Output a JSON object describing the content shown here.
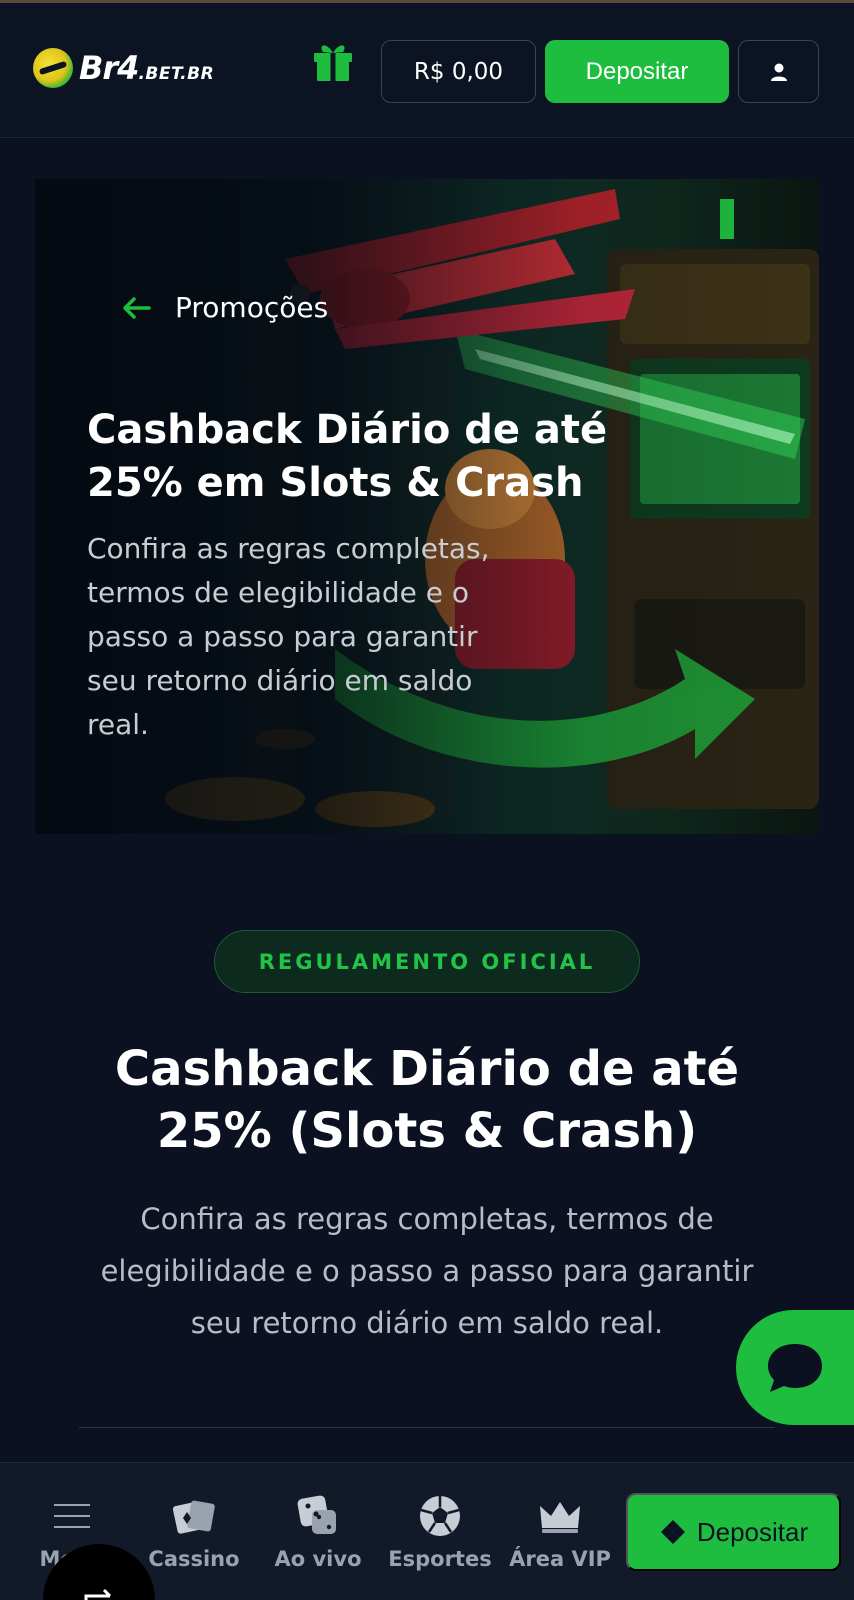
{
  "header": {
    "logo": {
      "brand": "Br4",
      "suffix": ".BET.BR"
    },
    "balance": "R$ 0,00",
    "deposit_label": "Depositar"
  },
  "banner": {
    "back_label": "Promoções",
    "title": "Cashback Diário de até 25% em Slots & Crash",
    "subtitle": "Confira as regras completas, termos de elegibilidade e o passo a passo para garantir seu retorno diário em saldo real."
  },
  "regulamento": {
    "badge": "REGULAMENTO OFICIAL",
    "title": "Cashback Diário de até 25% (Slots & Crash)",
    "subtitle": "Confira as regras completas, termos de elegibilidade e o passo a passo para garantir seu retorno diário em saldo real."
  },
  "bottom_nav": {
    "items": [
      {
        "label": "Menu",
        "icon": "menu-icon"
      },
      {
        "label": "Cassino",
        "icon": "cards-icon"
      },
      {
        "label": "Ao vivo",
        "icon": "dice-icon"
      },
      {
        "label": "Esportes",
        "icon": "soccer-ball-icon"
      },
      {
        "label": "Área VIP",
        "icon": "crown-icon"
      }
    ],
    "deposit_label": "Depositar"
  },
  "colors": {
    "background": "#0b1120",
    "accent_green": "#1fbd3f",
    "badge_text": "#22c348"
  }
}
